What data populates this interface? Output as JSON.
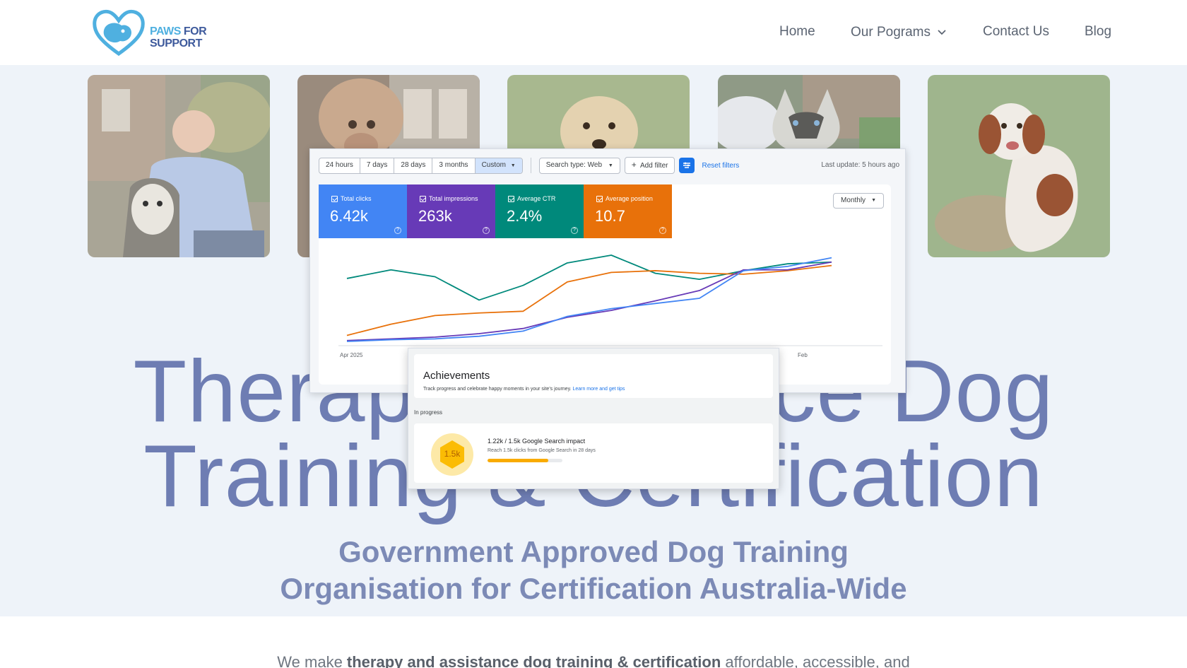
{
  "site": {
    "logo_line1a": "PAWS",
    "logo_line1b": " FOR",
    "logo_line2": "SUPPORT"
  },
  "nav": {
    "home": "Home",
    "programs": "Our Pograms",
    "contact": "Contact Us",
    "blog": "Blog"
  },
  "hero": {
    "title_line1": "Therapy & Service Dog",
    "title_line2": "Training & Certification",
    "subtitle_line1": "Government Approved Dog Training",
    "subtitle_line2": "Organisation for Certification Australia-Wide",
    "tagline_pre": "We make ",
    "tagline_bold": "therapy and assistance dog training & certification",
    "tagline_post": " affordable, accessible, and"
  },
  "search_console": {
    "ranges": [
      "24 hours",
      "7 days",
      "28 days",
      "3 months",
      "Custom"
    ],
    "active_range": "Custom",
    "search_type": "Search type: Web",
    "add_filter": "Add filter",
    "reset_filters": "Reset filters",
    "last_update": "Last update: 5 hours ago",
    "granularity": "Monthly",
    "metrics": [
      {
        "label": "Total clicks",
        "value": "6.42k",
        "color": "#4285f4"
      },
      {
        "label": "Total impressions",
        "value": "263k",
        "color": "#673ab7"
      },
      {
        "label": "Average CTR",
        "value": "2.4%",
        "color": "#00897b"
      },
      {
        "label": "Average position",
        "value": "10.7",
        "color": "#e8710a"
      }
    ]
  },
  "chart_data": {
    "type": "line",
    "x_labels": [
      "Apr 2025",
      "Feb"
    ],
    "y_scale": "normalized 0-1 per series (no axis values printed)",
    "grid": false,
    "legend": "none",
    "series": [
      {
        "color": "#00897b",
        "values": [
          0.73,
          0.83,
          0.75,
          0.48,
          0.65,
          0.91,
          1.0,
          0.79,
          0.72,
          0.82,
          0.9,
          0.92
        ]
      },
      {
        "color": "#e8710a",
        "values": [
          0.07,
          0.2,
          0.3,
          0.33,
          0.35,
          0.69,
          0.8,
          0.82,
          0.79,
          0.78,
          0.82,
          0.88
        ]
      },
      {
        "color": "#673ab7",
        "values": [
          0.01,
          0.03,
          0.05,
          0.09,
          0.15,
          0.28,
          0.36,
          0.47,
          0.59,
          0.83,
          0.83,
          0.92
        ]
      },
      {
        "color": "#4285f4",
        "values": [
          0.0,
          0.02,
          0.03,
          0.06,
          0.12,
          0.29,
          0.38,
          0.44,
          0.5,
          0.82,
          0.87,
          0.97
        ]
      }
    ]
  },
  "achievements": {
    "title": "Achievements",
    "description": "Track progress and celebrate happy moments in your site's journey.",
    "link": "Learn more and get tips",
    "section": "In progress",
    "badge": "1.5k",
    "item_title": "1.22k / 1.5k Google Search impact",
    "item_desc": "Reach 1.5k clicks from Google Search in 28 days",
    "progress": 0.81
  }
}
